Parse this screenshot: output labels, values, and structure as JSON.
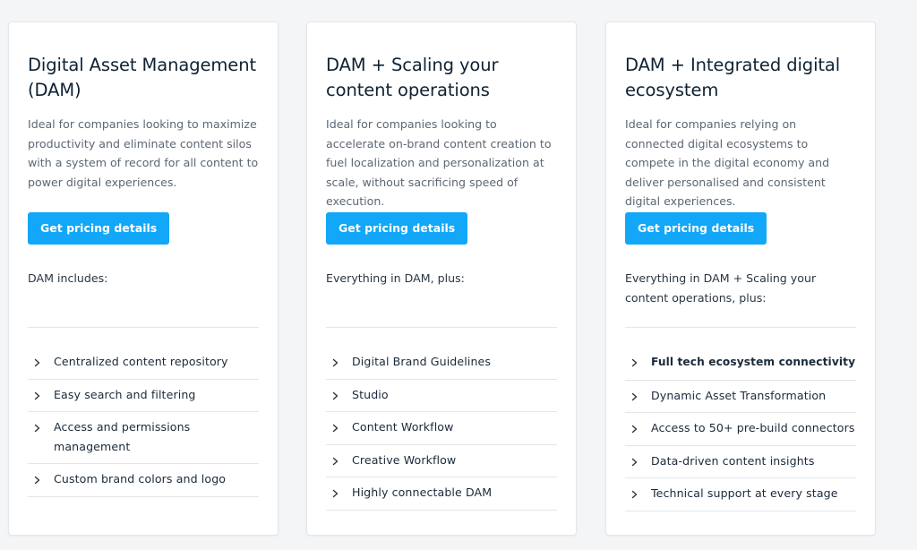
{
  "cards": [
    {
      "title": "Digital Asset Management (DAM)",
      "description": "Ideal for companies looking to maximize productivity and eliminate content silos with a system of record for all content to power digital experiences.",
      "button_label": "Get pricing details",
      "includes_label": "DAM includes:",
      "features": [
        "Centralized content repository",
        "Easy search and filtering",
        "Access and permissions management",
        "Custom brand colors and logo"
      ]
    },
    {
      "title": "DAM + Scaling your content operations",
      "description": "Ideal for companies looking to accelerate on-brand content creation to fuel localization and personalization at scale, without sacrificing speed of execution.",
      "button_label": "Get pricing details",
      "includes_label": "Everything in DAM, plus:",
      "features": [
        "Digital Brand Guidelines",
        "Studio",
        "Content Workflow",
        "Creative Workflow",
        "Highly connectable DAM"
      ]
    },
    {
      "title": "DAM + Integrated digital ecosystem",
      "description": "Ideal for companies relying on connected digital ecosystems to compete in the digital economy and deliver personalised and consistent digital experiences.",
      "button_label": "Get pricing details",
      "includes_label": "Everything in DAM + Scaling your content operations, plus:",
      "features": [
        "Full tech ecosystem connectivity",
        "Dynamic Asset Transformation",
        "Access to 50+ pre-build connectors",
        "Data-driven content insights",
        "Technical support at every stage"
      ]
    }
  ],
  "colors": {
    "accent": "#12a7f8",
    "background": "#f4f5f7",
    "card": "#ffffff",
    "divider": "#e3e6ea"
  },
  "icons": {
    "list_bullet": "chevron-right-icon"
  }
}
